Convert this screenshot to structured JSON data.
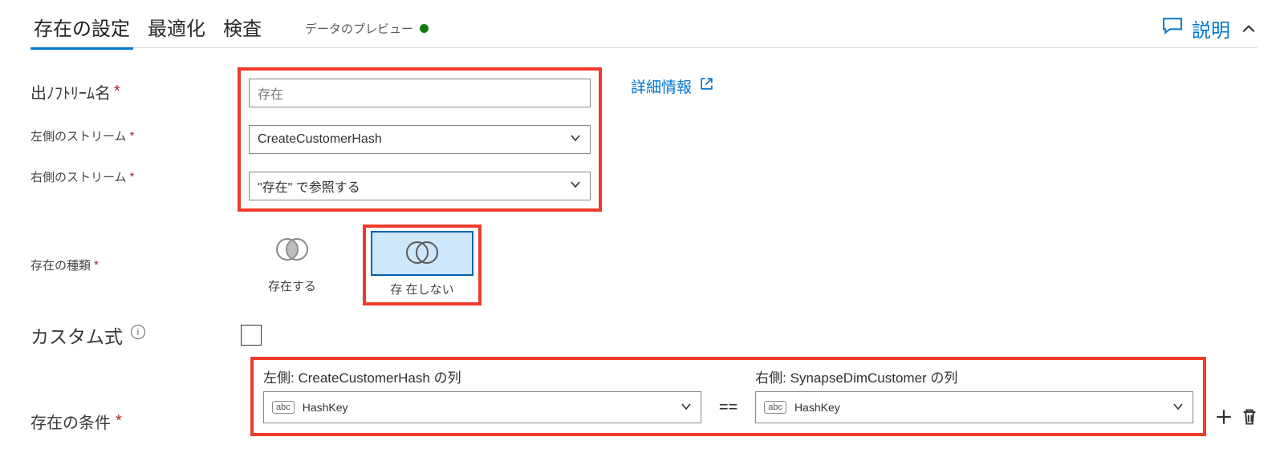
{
  "tabs": {
    "settings": "存在の設定",
    "optimize": "最適化",
    "inspect": "検査",
    "preview": "データのプレビュー"
  },
  "header": {
    "description_label": "説明"
  },
  "fields": {
    "output_stream_label": "出ﾉﾌﾄﾘｰﾑ名",
    "output_stream_value": "存在",
    "left_stream_label": "左側のストリーム",
    "left_stream_value": "CreateCustomerHash",
    "right_stream_label": "右側のストリーム",
    "right_stream_value": "\"存在\" で参照する",
    "learn_more": "詳細情報",
    "exist_type_label": "存在の種類",
    "exist_type_options": {
      "exists": "存在する",
      "not_exists": "存 在しない"
    },
    "custom_expr_label": "カスタム式",
    "conditions_label": "存在の条件",
    "cond_left_header": "左側: CreateCustomerHash の列",
    "cond_right_header": "右側: SynapseDimCustomer の列",
    "cond_left_value": "HashKey",
    "cond_right_value": "HashKey",
    "equals": "=="
  }
}
